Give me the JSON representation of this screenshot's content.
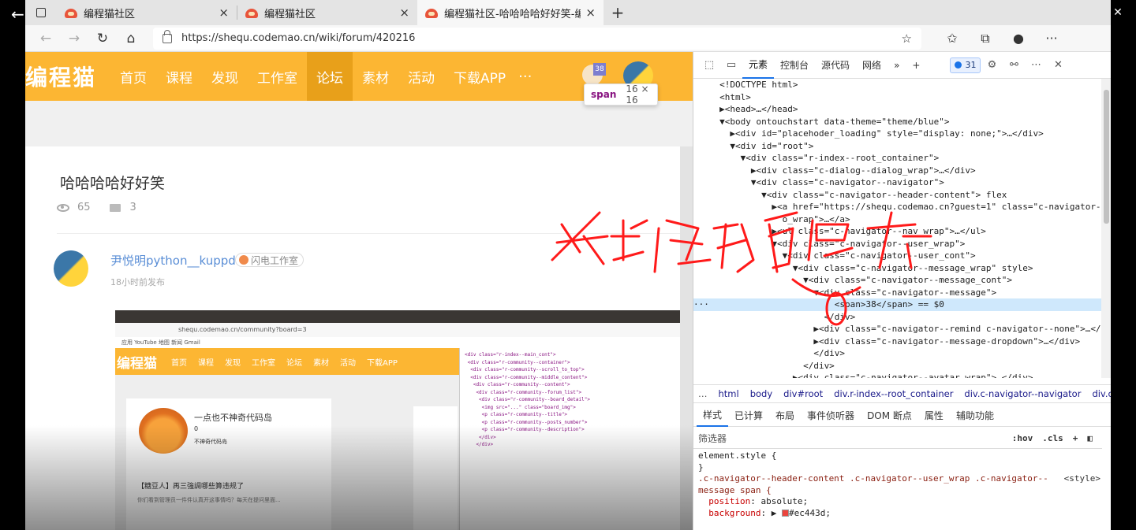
{
  "browser": {
    "tabs": [
      {
        "title": "编程猫社区",
        "close": "×"
      },
      {
        "title": "编程猫社区",
        "close": "×"
      },
      {
        "title": "编程猫社区-哈哈哈哈好好笑-编程",
        "close": "×"
      }
    ],
    "new_tab": "+",
    "url": "https://shequ.codemao.cn/wiki/forum/420216",
    "back_label": "←",
    "window_controls": [
      "—",
      "❐",
      "✕"
    ]
  },
  "site": {
    "logo": "编程猫",
    "nav": [
      "首页",
      "课程",
      "发现",
      "工作室",
      "论坛",
      "素材",
      "活动",
      "下载APP"
    ],
    "nav_more": "···",
    "message_count": "38",
    "tooltip": {
      "tag": "span",
      "size": "16 × 16"
    }
  },
  "post": {
    "title": "哈哈哈哈好好笑",
    "views": "65",
    "comments": "3",
    "author": "尹悦明python__kuppd",
    "studio": "闪电工作室",
    "time": "18小时前发布"
  },
  "embed": {
    "url": "shequ.codemao.cn/community?board=3",
    "bookmarks": "应用  YouTube  地图  新闻  Gmail",
    "logo": "编程猫",
    "nav": [
      "首页",
      "课程",
      "发现",
      "工作室",
      "论坛",
      "素材",
      "活动",
      "下载APP"
    ],
    "card_title": "一点也不神奇代码岛",
    "card_count": "0",
    "card_desc": "不神奇代码岛",
    "post_title": "【糖豆人】再三強調哪些算违规了",
    "post_excerpt": "你们看到管理员一件件认真开这事情吗？每天在提问里面..."
  },
  "devtools": {
    "tabs": [
      "元素",
      "控制台",
      "源代码",
      "网络"
    ],
    "more": "»",
    "add": "+",
    "issues": "31",
    "dom_lines": [
      "<!DOCTYPE html>",
      "<html>",
      "▶<head>…</head>",
      "▼<body ontouchstart data-theme=\"theme/blue\">",
      "  ▶<div id=\"placehoder_loading\" style=\"display: none;\">…</div>",
      "  ▼<div id=\"root\">",
      "    ▼<div class=\"r-index--root_container\">",
      "      ▶<div class=\"c-dialog--dialog_wrap\">…</div>",
      "      ▼<div class=\"c-navigator--navigator\">",
      "        ▼<div class=\"c-navigator--header-content\"> flex",
      "          ▶<a href=\"https://shequ.codemao.cn?guest=1\" class=\"c-navigator--log",
      "            o_wrap\">…</a>",
      "          ▶<ul class=\"c-navigator--nav_wrap\">…</ul>",
      "          ▼<div class=\"c-navigator--user_wrap\">",
      "            ▼<div class=\"c-navigator--user_cont\">",
      "              ▼<div class=\"c-navigator--message_wrap\" style>",
      "                ▼<div class=\"c-navigator--message_cont\">",
      "                  ▼<div class=\"c-navigator--message\">",
      "                      <span>38</span> == $0",
      "                    </div>",
      "                  ▶<div class=\"c-navigator--remind c-navigator--none\">…</div>",
      "                  ▶<div class=\"c-navigator--message-dropdown\">…</div>",
      "                  </div>",
      "                </div>",
      "              ▶<div class=\"c-navigator--avatar_wrap\">…</div>"
    ],
    "dom_dots": "···",
    "breadcrumbs": [
      "html",
      "body",
      "div#root",
      "div.r-index--root_container",
      "div.c-navigator--navigator",
      "div.c-na"
    ],
    "breadcrumb_dots": "…",
    "style_tabs": [
      "样式",
      "已计算",
      "布局",
      "事件侦听器",
      "DOM 断点",
      "属性",
      "辅助功能"
    ],
    "filter_placeholder": "筛选器",
    "filter_tools": [
      ":hov",
      ".cls",
      "+"
    ],
    "rule1_selector": "element.style {",
    "rule1_close": "}",
    "rule2_selector_a": ".c-navigator--header-content .c-navigator--user_wrap .c-navigator--",
    "rule2_selector_b": "message span {",
    "rule2_source": "<style>",
    "rule2_prop1": "position",
    "rule2_val1": "absolute;",
    "rule2_prop2": "background",
    "rule2_val2": "#ec443d;"
  },
  "annotation_text": "我去修改后的",
  "colors": {
    "brand": "#fcb633",
    "brand_active": "#e8a01a",
    "badge": "#ec443d",
    "ink": "#ff1a1a"
  }
}
